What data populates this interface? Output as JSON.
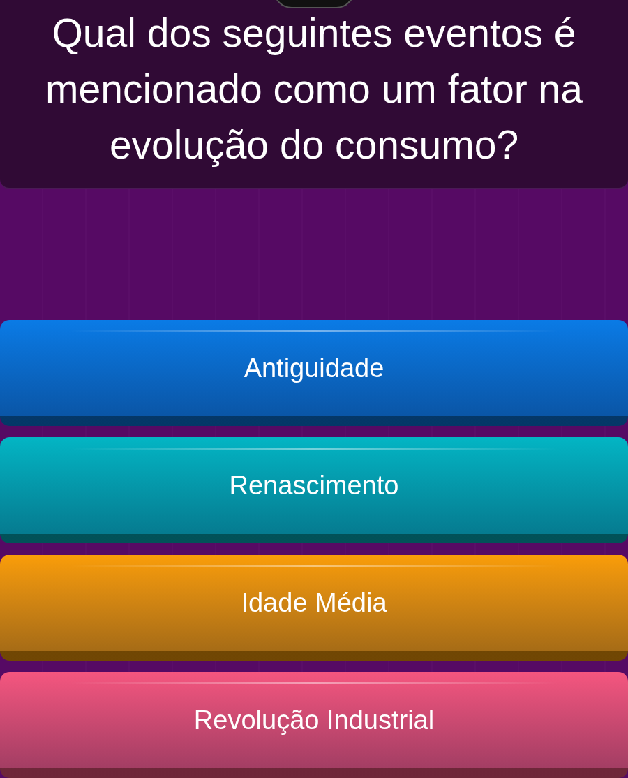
{
  "question": "Qual dos seguintes eventos é mencionado como um fator na evolução do consumo?",
  "answers": [
    {
      "label": "Antiguidade",
      "color": "#0a7be6"
    },
    {
      "label": "Renascimento",
      "color": "#03b5c4"
    },
    {
      "label": "Idade Média",
      "color": "#fa9d08"
    },
    {
      "label": "Revolução Industrial",
      "color": "#f5567f"
    }
  ]
}
